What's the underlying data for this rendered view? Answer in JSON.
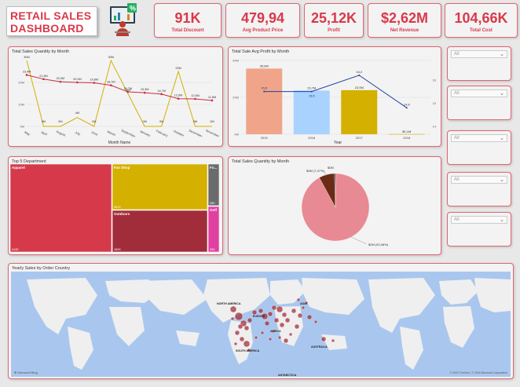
{
  "header": {
    "title_line1": "RETAIL SALES",
    "title_line2": "DASHBOARD"
  },
  "kpis": [
    {
      "value": "91K",
      "label": "Total Discount"
    },
    {
      "value": "479,94",
      "label": "Avg Product Price"
    },
    {
      "value": "25,12K",
      "label": "Profit"
    },
    {
      "value": "$2,62M",
      "label": "Net Revenue"
    },
    {
      "value": "104,66K",
      "label": "Total Cost"
    }
  ],
  "charts": {
    "qty_month_title": "Total Sales Quantity by Month",
    "avg_profit_title": "Total Sale Avg Profit by Month",
    "top5_title": "Top 5 Department",
    "qty_pie_title": "Total Sales Quantity by Month",
    "map_title": "Yearly Sales by Order Country"
  },
  "slicers": [
    {
      "value": "All"
    },
    {
      "value": "All"
    },
    {
      "value": "All"
    },
    {
      "value": "All"
    },
    {
      "value": "All"
    }
  ],
  "colors": {
    "accent": "#d9394a",
    "border": "#e06670",
    "line1": "#c62d3c",
    "line2": "#d4b000"
  },
  "chart_data": [
    {
      "type": "line",
      "title": "Total Sales Quantity by Month",
      "xlabel": "Month Name",
      "ylabel": "",
      "categories": [
        "May",
        "April",
        "August",
        "July",
        "June",
        "March",
        "September",
        "January",
        "February",
        "October",
        "December",
        "November"
      ],
      "series": [
        {
          "name": "",
          "values": [
            23.4,
            21.5,
            20.3,
            20.0,
            19.8,
            18.7,
            15.7,
            15.3,
            14.7,
            12.6,
            12.5,
            11.8
          ]
        },
        {
          "name": "",
          "values": [
            30,
            0,
            0,
            4,
            0,
            30,
            15,
            0,
            0,
            25,
            0,
            0
          ]
        }
      ],
      "data_labels_1": [
        "23,4M",
        "21,5M",
        "20,3M",
        "20,0M",
        "19,8M",
        "18,7M",
        "15,7M",
        "15,3M",
        "14,7M",
        "12,6M",
        "12,5M",
        "11,8M"
      ],
      "data_labels_2": [
        "30M",
        "0M",
        "0M",
        "4M",
        "0M",
        "30M",
        "15M",
        "0M",
        "0M",
        "25M",
        "0M",
        "0M"
      ],
      "yticks": [
        "20M",
        "10M",
        "0M"
      ]
    },
    {
      "type": "bar",
      "title": "Total Sale Avg Profit by Month",
      "xlabel": "Year",
      "categories": [
        "2015",
        "2016",
        "2017",
        "2018"
      ],
      "series": [
        {
          "name": "",
          "values": [
            35.6,
            23.7,
            23.9,
            0.1
          ],
          "labels": [
            "35,6M",
            "23,7M",
            "23,9M",
            "$0,1M"
          ]
        },
        {
          "name": "",
          "values": [
            15.5,
            15.5,
            16.2,
            14.8
          ],
          "labels": [
            "15,5",
            "15,5",
            "16,2",
            "14,8"
          ]
        }
      ],
      "yticks_left": [
        "40M",
        "20M",
        "0M"
      ],
      "yticks_right": [
        "16",
        "15",
        "14"
      ]
    },
    {
      "type": "heatmap",
      "title": "Top 5 Department",
      "categories": [
        "Apparel",
        "Fan Shop",
        "Outdoors",
        "Fo...",
        "Golf"
      ],
      "labels": [
        "412K",
        "387K",
        "182K",
        "39K",
        "32K"
      ]
    },
    {
      "type": "pie",
      "title": "Total Sales Quantity by Month",
      "categories": [
        "$2M (92,08%)",
        "$0M (7,47%)",
        "$0M"
      ],
      "values": [
        92.08,
        7.47,
        0.45
      ]
    }
  ],
  "map": {
    "labels": [
      "NORTH AMERICA",
      "EUROPE",
      "ASIA",
      "AFRICA",
      "SOUTH AMERICA",
      "AUSTRALIA",
      "ANTARCTICA"
    ],
    "attribution": "© 2024 TomTom, © 2024 Microsoft Corporation"
  }
}
